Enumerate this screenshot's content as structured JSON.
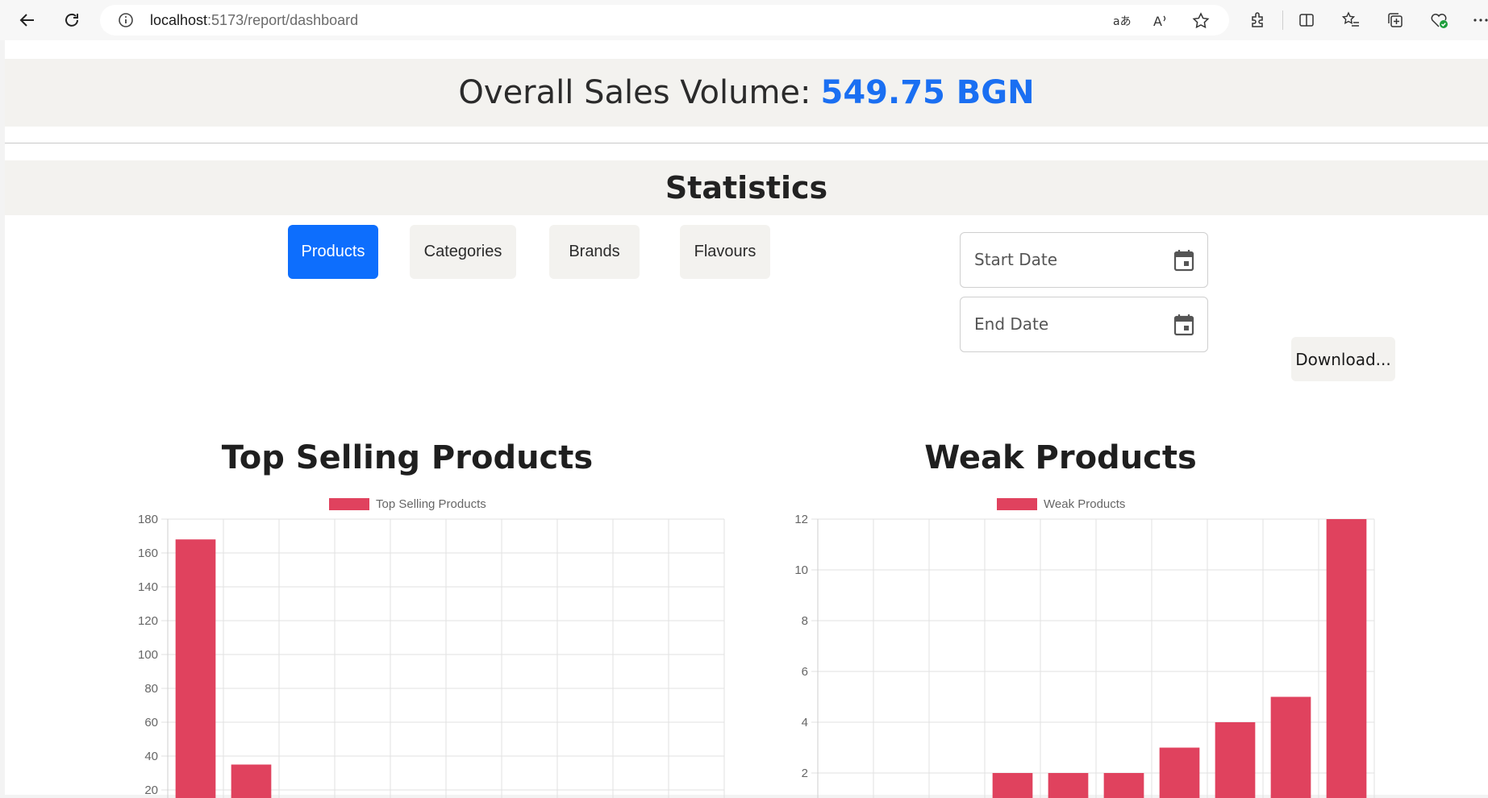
{
  "browser": {
    "url_host": "localhost",
    "url_rest": ":5173/report/dashboard"
  },
  "header": {
    "sales_label": "Overall Sales Volume:",
    "sales_value": "549.75 BGN",
    "stats_title": "Statistics"
  },
  "tabs": [
    {
      "label": "Products",
      "active": true
    },
    {
      "label": "Categories",
      "active": false
    },
    {
      "label": "Brands",
      "active": false
    },
    {
      "label": "Flavours",
      "active": false
    }
  ],
  "filters": {
    "start_date": "Start Date",
    "end_date": "End Date",
    "download": "Download..."
  },
  "colors": {
    "accent": "#0d6efd",
    "sales_value": "#1a6ff2",
    "bar": "#e0425e"
  },
  "chart_data": [
    {
      "type": "bar",
      "title": "Top Selling Products",
      "legend": "Top Selling Products",
      "categories": [
        "",
        "",
        "",
        "",
        "",
        "",
        "",
        "",
        "",
        ""
      ],
      "values": [
        168,
        35,
        0,
        0,
        0,
        0,
        0,
        0,
        0,
        0
      ],
      "yticks": [
        20,
        40,
        60,
        80,
        100,
        120,
        140,
        160,
        180
      ],
      "ylim": [
        0,
        180
      ],
      "grid": true,
      "legend_position": "top"
    },
    {
      "type": "bar",
      "title": "Weak Products",
      "legend": "Weak Products",
      "categories": [
        "",
        "",
        "",
        "",
        "",
        "",
        "",
        "",
        "",
        ""
      ],
      "values": [
        0,
        0,
        0,
        2,
        2,
        2,
        3,
        4,
        5,
        12
      ],
      "yticks": [
        2,
        4,
        6,
        8,
        10,
        12
      ],
      "ylim": [
        0,
        12
      ],
      "grid": true,
      "legend_position": "top"
    }
  ]
}
